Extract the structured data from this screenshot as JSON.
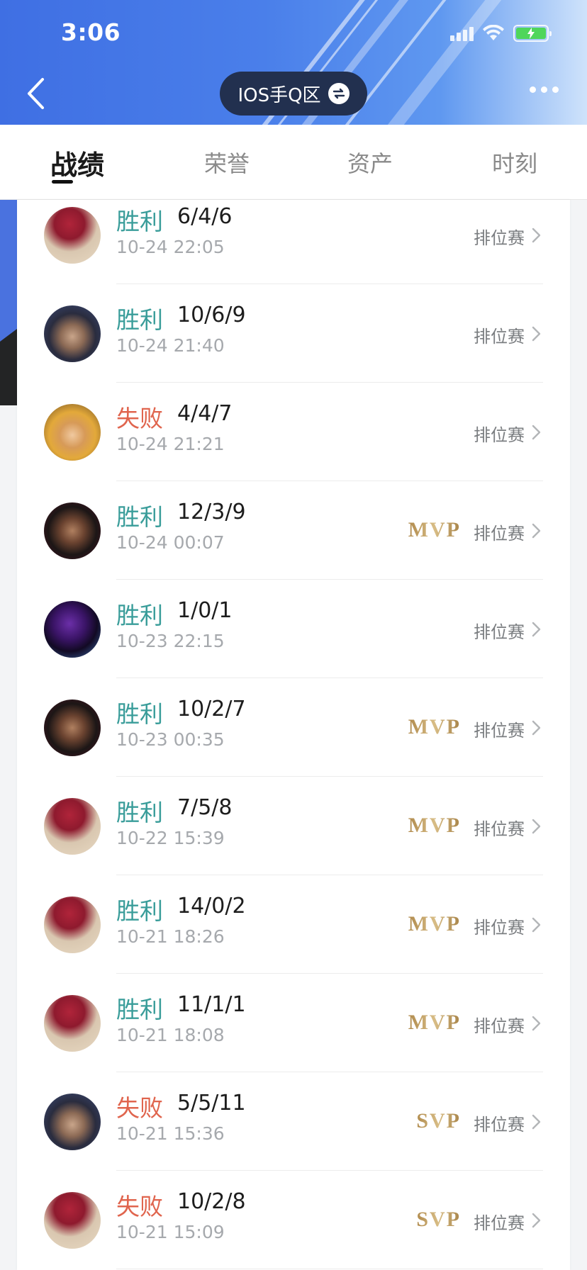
{
  "status_bar": {
    "time": "3:06"
  },
  "header": {
    "server_label": "IOS手Q区",
    "colors": {
      "gradient_start": "#3f6fe3",
      "pill_bg": "#22304f"
    }
  },
  "tabs": [
    {
      "label": "战绩",
      "active": true
    },
    {
      "label": "荣誉",
      "active": false
    },
    {
      "label": "资产",
      "active": false
    },
    {
      "label": "时刻",
      "active": false
    }
  ],
  "colors": {
    "win": "#3a9d9a",
    "loss": "#e0654e",
    "badge_gold": "#b08a4c"
  },
  "matches": [
    {
      "result": "胜利",
      "outcome": "win",
      "kda": "6/4/6",
      "time": "10-24 22:05",
      "badge": "",
      "mode": "排位赛",
      "hero_icon": "hero-red-hair-avatar"
    },
    {
      "result": "胜利",
      "outcome": "win",
      "kda": "10/6/9",
      "time": "10-24 21:40",
      "badge": "",
      "mode": "排位赛",
      "hero_icon": "hero-dark-hair-swordsman-avatar"
    },
    {
      "result": "失败",
      "outcome": "loss",
      "kda": "4/4/7",
      "time": "10-24 21:21",
      "badge": "",
      "mode": "排位赛",
      "hero_icon": "hero-golden-hair-avatar"
    },
    {
      "result": "胜利",
      "outcome": "win",
      "kda": "12/3/9",
      "time": "10-24 00:07",
      "badge": "MVP",
      "mode": "排位赛",
      "hero_icon": "hero-bearded-man-avatar"
    },
    {
      "result": "胜利",
      "outcome": "win",
      "kda": "1/0/1",
      "time": "10-23 22:15",
      "badge": "",
      "mode": "排位赛",
      "hero_icon": "hero-purple-hooded-avatar"
    },
    {
      "result": "胜利",
      "outcome": "win",
      "kda": "10/2/7",
      "time": "10-23 00:35",
      "badge": "MVP",
      "mode": "排位赛",
      "hero_icon": "hero-bearded-man-avatar"
    },
    {
      "result": "胜利",
      "outcome": "win",
      "kda": "7/5/8",
      "time": "10-22 15:39",
      "badge": "MVP",
      "mode": "排位赛",
      "hero_icon": "hero-red-hair-avatar"
    },
    {
      "result": "胜利",
      "outcome": "win",
      "kda": "14/0/2",
      "time": "10-21 18:26",
      "badge": "MVP",
      "mode": "排位赛",
      "hero_icon": "hero-red-hair-avatar"
    },
    {
      "result": "胜利",
      "outcome": "win",
      "kda": "11/1/1",
      "time": "10-21 18:08",
      "badge": "MVP",
      "mode": "排位赛",
      "hero_icon": "hero-red-hair-avatar"
    },
    {
      "result": "失败",
      "outcome": "loss",
      "kda": "5/5/11",
      "time": "10-21 15:36",
      "badge": "SVP",
      "mode": "排位赛",
      "hero_icon": "hero-dark-hair-swordsman-avatar"
    },
    {
      "result": "失败",
      "outcome": "loss",
      "kda": "10/2/8",
      "time": "10-21 15:09",
      "badge": "SVP",
      "mode": "排位赛",
      "hero_icon": "hero-red-hair-avatar"
    }
  ]
}
